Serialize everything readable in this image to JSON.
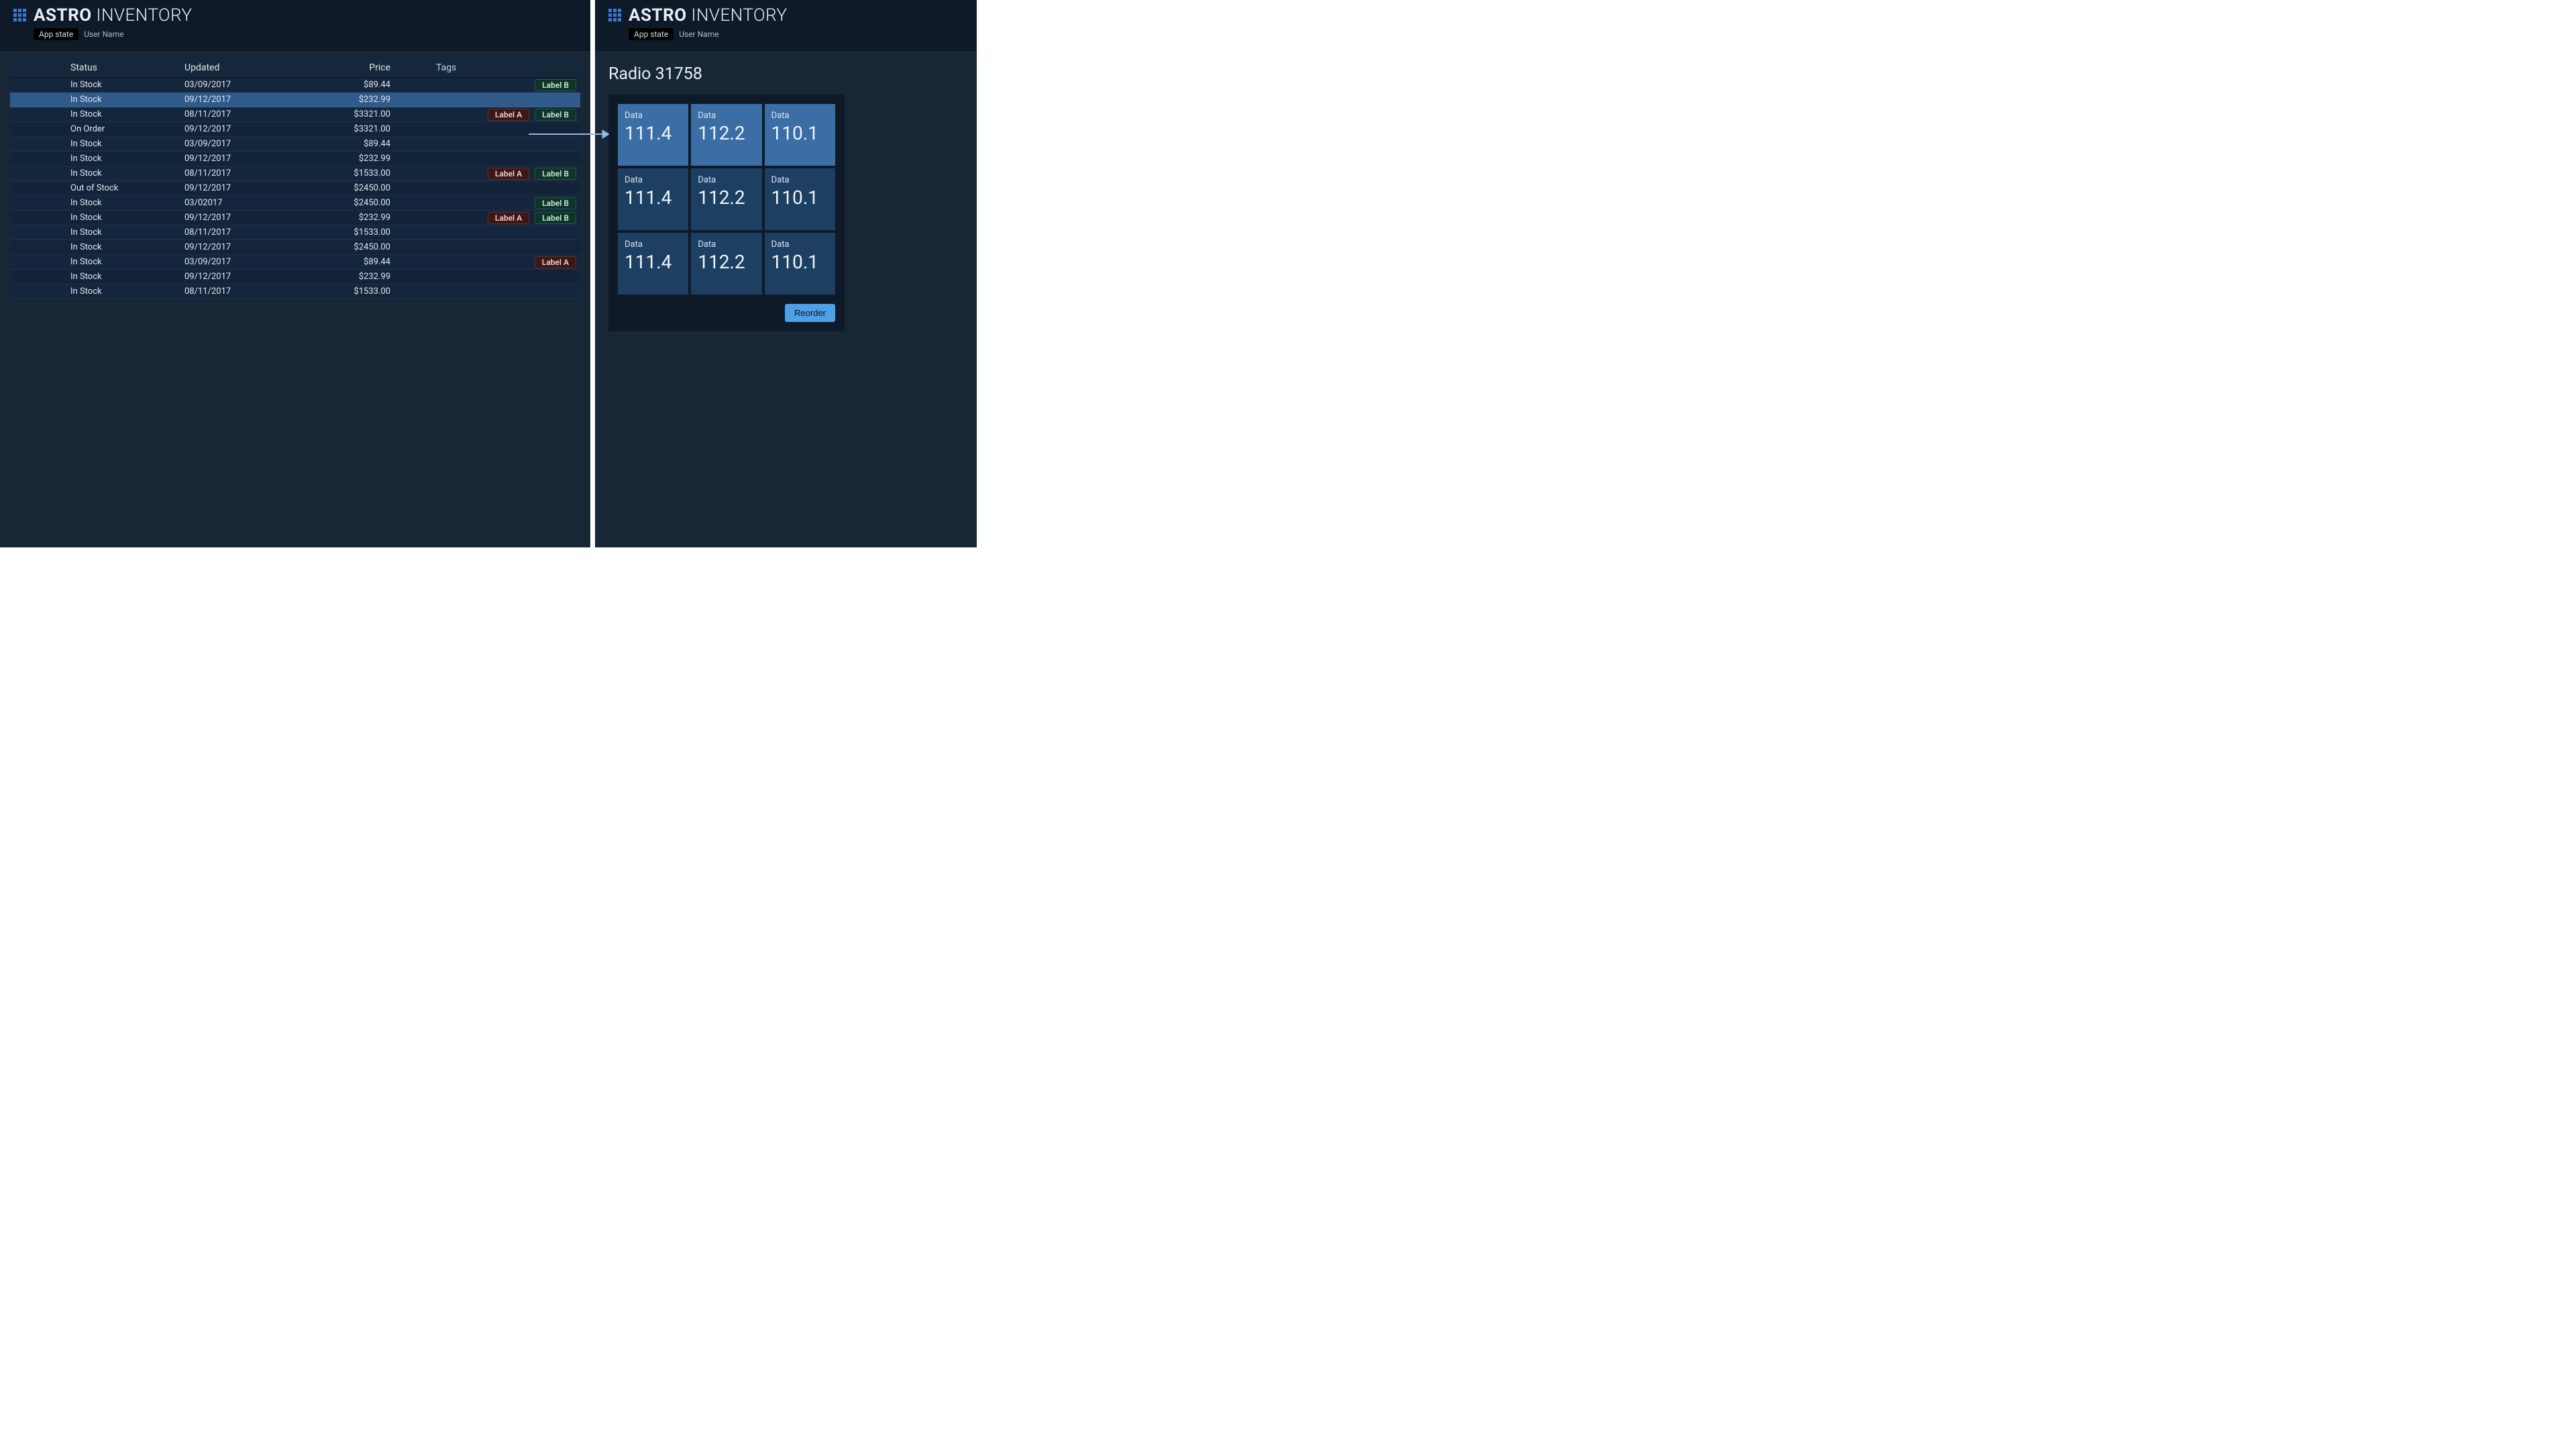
{
  "app": {
    "title_bold": "ASTRO",
    "title_light": "INVENTORY",
    "state_badge": "App state",
    "user_name": "User Name"
  },
  "table": {
    "headers": {
      "status": "Status",
      "updated": "Updated",
      "price": "Price",
      "tags": "Tags"
    },
    "rows": [
      {
        "status": "In Stock",
        "updated": "03/09/2017",
        "price": "$89.44",
        "tags": [
          "Label B"
        ],
        "selected": false
      },
      {
        "status": "In Stock",
        "updated": "09/12/2017",
        "price": "$232.99",
        "tags": [],
        "selected": true
      },
      {
        "status": "In Stock",
        "updated": "08/11/2017",
        "price": "$3321.00",
        "tags": [
          "Label A",
          "Label B"
        ],
        "selected": false
      },
      {
        "status": "On Order",
        "updated": "09/12/2017",
        "price": "$3321.00",
        "tags": [],
        "selected": false
      },
      {
        "status": "In Stock",
        "updated": "03/09/2017",
        "price": "$89.44",
        "tags": [],
        "selected": false
      },
      {
        "status": "In Stock",
        "updated": "09/12/2017",
        "price": "$232.99",
        "tags": [],
        "selected": false
      },
      {
        "status": "In Stock",
        "updated": "08/11/2017",
        "price": "$1533.00",
        "tags": [
          "Label A",
          "Label B"
        ],
        "selected": false
      },
      {
        "status": "Out of Stock",
        "updated": "09/12/2017",
        "price": "$2450.00",
        "tags": [],
        "selected": false
      },
      {
        "status": "In Stock",
        "updated": "03/02017",
        "price": "$2450.00",
        "tags": [
          "Label B"
        ],
        "selected": false
      },
      {
        "status": "In Stock",
        "updated": "09/12/2017",
        "price": "$232.99",
        "tags": [
          "Label A",
          "Label B"
        ],
        "selected": false
      },
      {
        "status": "In Stock",
        "updated": "08/11/2017",
        "price": "$1533.00",
        "tags": [],
        "selected": false
      },
      {
        "status": "In Stock",
        "updated": "09/12/2017",
        "price": "$2450.00",
        "tags": [],
        "selected": false
      },
      {
        "status": "In Stock",
        "updated": "03/09/2017",
        "price": "$89.44",
        "tags": [
          "Label A"
        ],
        "selected": false
      },
      {
        "status": "In Stock",
        "updated": "09/12/2017",
        "price": "$232.99",
        "tags": [],
        "selected": false
      },
      {
        "status": "In Stock",
        "updated": "08/11/2017",
        "price": "$1533.00",
        "tags": [],
        "selected": false
      }
    ]
  },
  "detail": {
    "title": "Radio 31758",
    "tiles": [
      {
        "label": "Data",
        "value": "111.4"
      },
      {
        "label": "Data",
        "value": "112.2"
      },
      {
        "label": "Data",
        "value": "110.1"
      },
      {
        "label": "Data",
        "value": "111.4"
      },
      {
        "label": "Data",
        "value": "112.2"
      },
      {
        "label": "Data",
        "value": "110.1"
      },
      {
        "label": "Data",
        "value": "111.4"
      },
      {
        "label": "Data",
        "value": "112.2"
      },
      {
        "label": "Data",
        "value": "110.1"
      }
    ],
    "reorder_label": "Reorder"
  }
}
